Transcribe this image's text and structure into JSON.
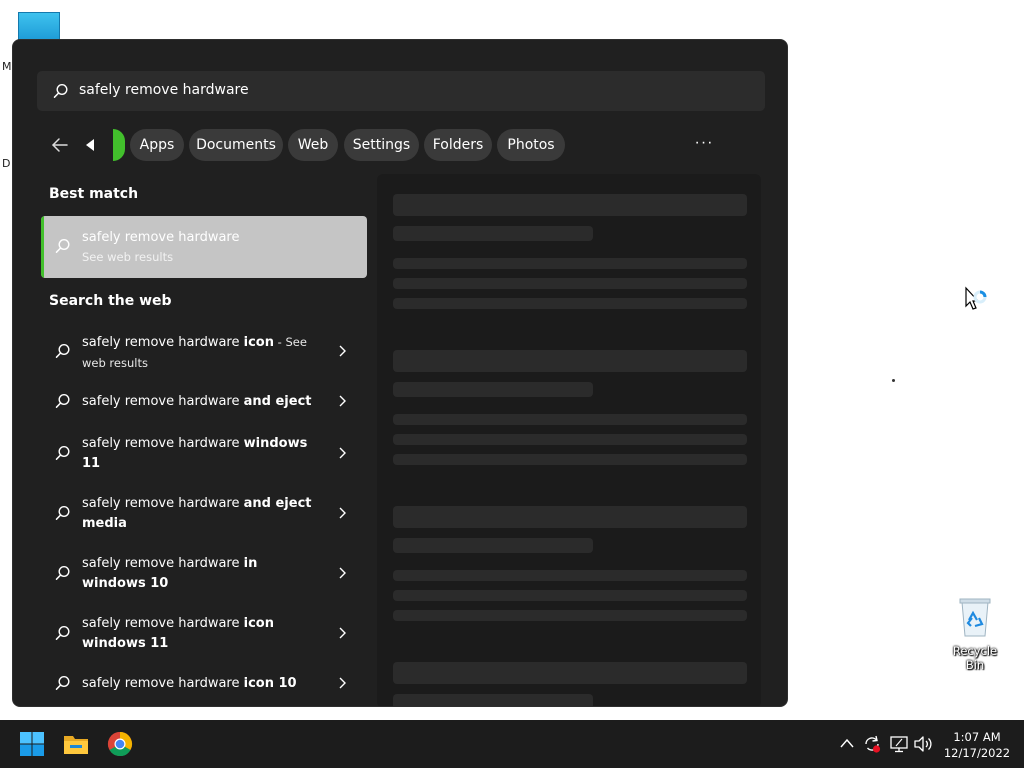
{
  "desktop": {
    "left_labels": [
      "M",
      "D"
    ],
    "recycle_bin_label": "Recycle Bin"
  },
  "search": {
    "query": "safely remove hardware"
  },
  "filters": {
    "items": [
      {
        "label": "Apps"
      },
      {
        "label": "Documents"
      },
      {
        "label": "Web"
      },
      {
        "label": "Settings"
      },
      {
        "label": "Folders"
      },
      {
        "label": "Photos"
      }
    ],
    "more_label": "···"
  },
  "best_match": {
    "section_title": "Best match",
    "title": "safely remove hardware",
    "subtitle": "See web results"
  },
  "web": {
    "section_title": "Search the web",
    "items": [
      {
        "prefix": "safely remove hardware ",
        "bold": "icon",
        "suffix": " - See web results"
      },
      {
        "prefix": "safely remove hardware ",
        "bold": "and eject",
        "suffix": ""
      },
      {
        "prefix": "safely remove hardware ",
        "bold": "windows 11",
        "suffix": ""
      },
      {
        "prefix": "safely remove hardware ",
        "bold": "and eject media",
        "suffix": ""
      },
      {
        "prefix": "safely remove hardware ",
        "bold": "in windows 10",
        "suffix": ""
      },
      {
        "prefix": "safely remove hardware ",
        "bold": "icon windows 11",
        "suffix": ""
      },
      {
        "prefix": "safely remove hardware ",
        "bold": "icon 10",
        "suffix": ""
      }
    ]
  },
  "taskbar": {
    "time": "1:07 AM",
    "date": "12/17/2022"
  },
  "colors": {
    "accent": "#42c02c",
    "panel_bg": "#202020",
    "taskbar_bg": "#1c1c1c"
  }
}
